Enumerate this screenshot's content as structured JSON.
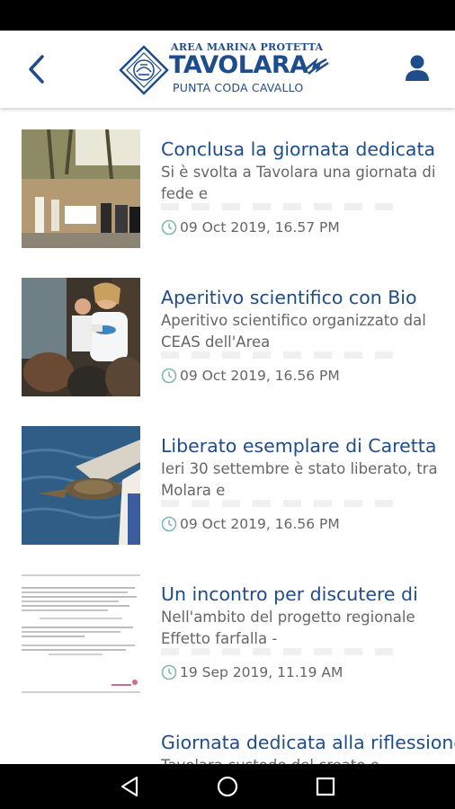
{
  "header": {
    "logo_top": "AREA MARINA PROTETTA",
    "logo_main": "TAVOLARA",
    "logo_bottom": "PUNTA CODA CAVALLO",
    "brand_color": "#1f4d8c",
    "back_icon": "chevron-left-icon",
    "profile_icon": "user-icon"
  },
  "news": [
    {
      "title": "Conclusa la giornata dedicata",
      "excerpt": "Si è svolta a Tavolara una giornata di fede e",
      "date": "09 Oct 2019, 16.57 PM"
    },
    {
      "title": "Aperitivo scientifico con Bio",
      "excerpt": "Aperitivo scientifico organizzato dal CEAS dell'Area",
      "date": "09 Oct 2019, 16.56 PM"
    },
    {
      "title": "Liberato esemplare di Caretta",
      "excerpt": "Ieri 30 settembre è stato liberato, tra Molara e",
      "date": "09 Oct 2019, 16.56 PM"
    },
    {
      "title": "Un incontro per discutere di",
      "excerpt": "Nell'ambito del progetto regionale Effetto farfalla -",
      "date": "19 Sep 2019, 11.19 AM"
    },
    {
      "title": "Giornata dedicata alla riflessione",
      "excerpt": "Tavolara custode del creato e",
      "date": ""
    }
  ],
  "navigation": {
    "back": "triangle-back-icon",
    "home": "circle-home-icon",
    "recents": "square-recents-icon"
  }
}
